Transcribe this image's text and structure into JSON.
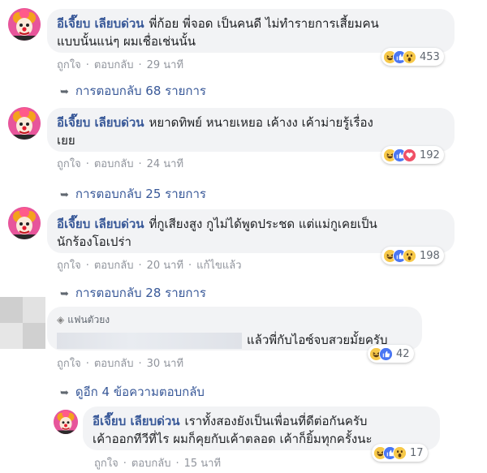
{
  "comments": [
    {
      "author": "อีเจี๊ยบ เลียบด่วน",
      "text_line1": "พี่ก้อย พี่จอด เป็นคนดี ไม่ทำรายการเสี้ยมคน",
      "text_line2": "แบบนั้นแน่ๆ ผมเชื่อเช่นนั้น",
      "like": "ถูกใจ",
      "reply": "ตอบกลับ",
      "time": "29 นาที",
      "reaction_count": "453",
      "replies_label": "การตอบกลับ 68 รายการ"
    },
    {
      "author": "อีเจี๊ยบ เลียบด่วน",
      "text_line1": "หยาดทิพย์ หนายเหยอ เค้างง เค้าม่ายรู้เรื่อง",
      "text_line2": "เยย",
      "like": "ถูกใจ",
      "reply": "ตอบกลับ",
      "time": "24 นาที",
      "reaction_count": "192",
      "replies_label": "การตอบกลับ 25 รายการ"
    },
    {
      "author": "อีเจี๊ยบ เลียบด่วน",
      "text_line1": "ที่กูเสียงสูง กูไม่ได้พูดประชด แต่แม่กูเคยเป็น",
      "text_line2": "นักร้องโอเปร่า",
      "like": "ถูกใจ",
      "reply": "ตอบกลับ",
      "time": "20 นาที",
      "edited": "แก้ไขแล้ว",
      "reaction_count": "198",
      "replies_label": "การตอบกลับ 28 รายการ"
    },
    {
      "fan_badge": "แฟนตัวยง",
      "text": "แล้วพี่กับไอซ์จบสวยมั้ยครับ",
      "like": "ถูกใจ",
      "reply": "ตอบกลับ",
      "time": "30 นาที",
      "reaction_count": "42",
      "replies_label": "ดูอีก 4 ข้อความตอบกลับ"
    },
    {
      "author": "อีเจี๊ยบ เลียบด่วน",
      "text_line1": "เราทั้งสองยังเป็นเพื่อนที่ดีต่อกันครับ",
      "text_line2": "เค้าออกทีวีที่ไร ผมก็คุยกับเค้าตลอด เค้าก็ยิ้มทุกครั้งนะ",
      "like": "ถูกใจ",
      "reply": "ตอบกลับ",
      "time": "15 นาที",
      "reaction_count": "17"
    }
  ],
  "colors": {
    "link": "#385898",
    "bubble": "#f2f3f5",
    "meta": "#90949c"
  },
  "icons": [
    "avatar-clown",
    "haha-icon",
    "like-icon",
    "wow-icon",
    "love-icon",
    "reply-arrow-icon",
    "diamond-icon"
  ]
}
